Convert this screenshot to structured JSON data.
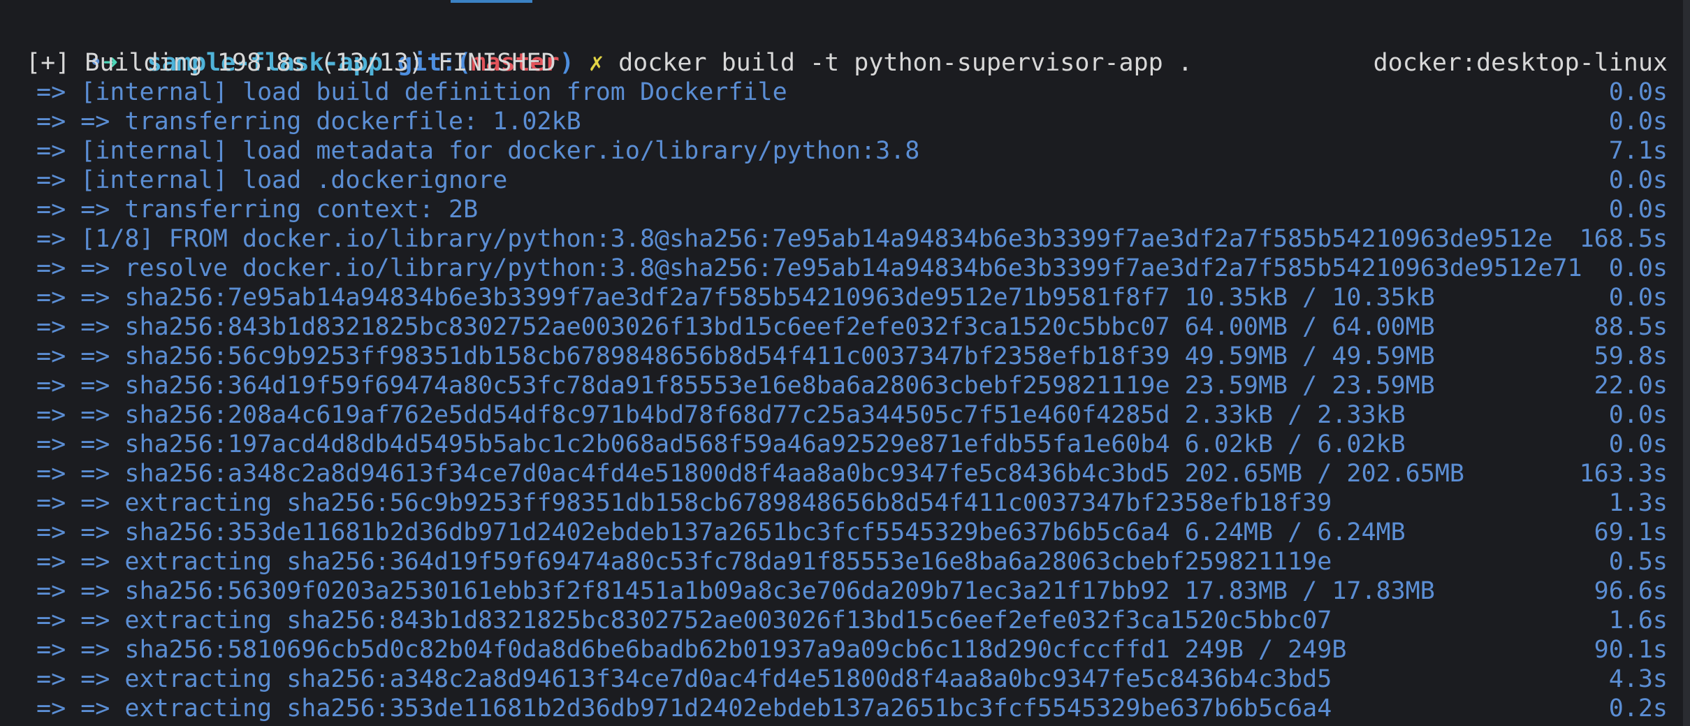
{
  "prompt": {
    "dot": "•",
    "arrow": "➜",
    "dir": "sample-flask-app",
    "git_prefix": "git:(",
    "branch": "master",
    "git_suffix": ")",
    "dirty_mark": "✗",
    "command": "docker build -t python-supervisor-app ."
  },
  "status": {
    "text": "[+] Building 198.8s (13/13) FINISHED",
    "context": "docker:desktop-linux"
  },
  "steps": [
    {
      "text": "=> [internal] load build definition from Dockerfile",
      "time": "0.0s"
    },
    {
      "text": "=> => transferring dockerfile: 1.02kB",
      "time": "0.0s"
    },
    {
      "text": "=> [internal] load metadata for docker.io/library/python:3.8",
      "time": "7.1s"
    },
    {
      "text": "=> [internal] load .dockerignore",
      "time": "0.0s"
    },
    {
      "text": "=> => transferring context: 2B",
      "time": "0.0s"
    },
    {
      "text": "=> [1/8] FROM docker.io/library/python:3.8@sha256:7e95ab14a94834b6e3b3399f7ae3df2a7f585b54210963de9512e",
      "time": "168.5s"
    },
    {
      "text": "=> => resolve docker.io/library/python:3.8@sha256:7e95ab14a94834b6e3b3399f7ae3df2a7f585b54210963de9512e71",
      "time": "0.0s"
    },
    {
      "text": "=> => sha256:7e95ab14a94834b6e3b3399f7ae3df2a7f585b54210963de9512e71b9581f8f7 10.35kB / 10.35kB",
      "time": "0.0s"
    },
    {
      "text": "=> => sha256:843b1d8321825bc8302752ae003026f13bd15c6eef2efe032f3ca1520c5bbc07 64.00MB / 64.00MB",
      "time": "88.5s"
    },
    {
      "text": "=> => sha256:56c9b9253ff98351db158cb6789848656b8d54f411c0037347bf2358efb18f39 49.59MB / 49.59MB",
      "time": "59.8s"
    },
    {
      "text": "=> => sha256:364d19f59f69474a80c53fc78da91f85553e16e8ba6a28063cbebf259821119e 23.59MB / 23.59MB",
      "time": "22.0s"
    },
    {
      "text": "=> => sha256:208a4c619af762e5dd54df8c971b4bd78f68d77c25a344505c7f51e460f4285d 2.33kB / 2.33kB",
      "time": "0.0s"
    },
    {
      "text": "=> => sha256:197acd4d8db4d5495b5abc1c2b068ad568f59a46a92529e871efdb55fa1e60b4 6.02kB / 6.02kB",
      "time": "0.0s"
    },
    {
      "text": "=> => sha256:a348c2a8d94613f34ce7d0ac4fd4e51800d8f4aa8a0bc9347fe5c8436b4c3bd5 202.65MB / 202.65MB",
      "time": "163.3s"
    },
    {
      "text": "=> => extracting sha256:56c9b9253ff98351db158cb6789848656b8d54f411c0037347bf2358efb18f39",
      "time": "1.3s"
    },
    {
      "text": "=> => sha256:353de11681b2d36db971d2402ebdeb137a2651bc3fcf5545329be637b6b5c6a4 6.24MB / 6.24MB",
      "time": "69.1s"
    },
    {
      "text": "=> => extracting sha256:364d19f59f69474a80c53fc78da91f85553e16e8ba6a28063cbebf259821119e",
      "time": "0.5s"
    },
    {
      "text": "=> => sha256:56309f0203a2530161ebb3f2f81451a1b09a8c3e706da209b71ec3a21f17bb92 17.83MB / 17.83MB",
      "time": "96.6s"
    },
    {
      "text": "=> => extracting sha256:843b1d8321825bc8302752ae003026f13bd15c6eef2efe032f3ca1520c5bbc07",
      "time": "1.6s"
    },
    {
      "text": "=> => sha256:5810696cb5d0c82b04f0da8d6be6badb62b01937a9a09cb6c118d290cfccffd1 249B / 249B",
      "time": "90.1s"
    },
    {
      "text": "=> => extracting sha256:a348c2a8d94613f34ce7d0ac4fd4e51800d8f4aa8a0bc9347fe5c8436b4c3bd5",
      "time": "4.3s"
    },
    {
      "text": "=> => extracting sha256:353de11681b2d36db971d2402ebdeb137a2651bc3fcf5545329be637b6b5c6a4",
      "time": "0.2s"
    }
  ]
}
